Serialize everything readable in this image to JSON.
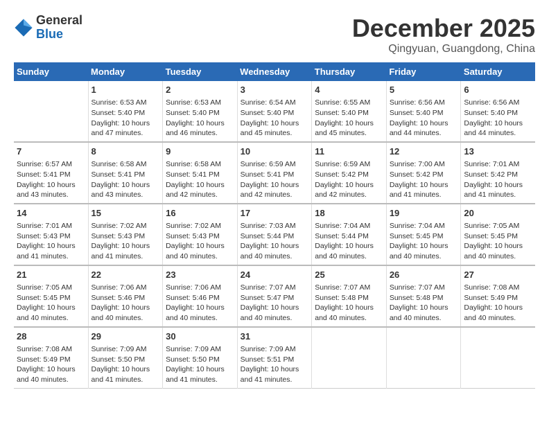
{
  "logo": {
    "line1": "General",
    "line2": "Blue"
  },
  "title": "December 2025",
  "location": "Qingyuan, Guangdong, China",
  "weekdays": [
    "Sunday",
    "Monday",
    "Tuesday",
    "Wednesday",
    "Thursday",
    "Friday",
    "Saturday"
  ],
  "weeks": [
    [
      {
        "day": "",
        "content": ""
      },
      {
        "day": "1",
        "content": "Sunrise: 6:53 AM\nSunset: 5:40 PM\nDaylight: 10 hours\nand 47 minutes."
      },
      {
        "day": "2",
        "content": "Sunrise: 6:53 AM\nSunset: 5:40 PM\nDaylight: 10 hours\nand 46 minutes."
      },
      {
        "day": "3",
        "content": "Sunrise: 6:54 AM\nSunset: 5:40 PM\nDaylight: 10 hours\nand 45 minutes."
      },
      {
        "day": "4",
        "content": "Sunrise: 6:55 AM\nSunset: 5:40 PM\nDaylight: 10 hours\nand 45 minutes."
      },
      {
        "day": "5",
        "content": "Sunrise: 6:56 AM\nSunset: 5:40 PM\nDaylight: 10 hours\nand 44 minutes."
      },
      {
        "day": "6",
        "content": "Sunrise: 6:56 AM\nSunset: 5:40 PM\nDaylight: 10 hours\nand 44 minutes."
      }
    ],
    [
      {
        "day": "7",
        "content": "Sunrise: 6:57 AM\nSunset: 5:41 PM\nDaylight: 10 hours\nand 43 minutes."
      },
      {
        "day": "8",
        "content": "Sunrise: 6:58 AM\nSunset: 5:41 PM\nDaylight: 10 hours\nand 43 minutes."
      },
      {
        "day": "9",
        "content": "Sunrise: 6:58 AM\nSunset: 5:41 PM\nDaylight: 10 hours\nand 42 minutes."
      },
      {
        "day": "10",
        "content": "Sunrise: 6:59 AM\nSunset: 5:41 PM\nDaylight: 10 hours\nand 42 minutes."
      },
      {
        "day": "11",
        "content": "Sunrise: 6:59 AM\nSunset: 5:42 PM\nDaylight: 10 hours\nand 42 minutes."
      },
      {
        "day": "12",
        "content": "Sunrise: 7:00 AM\nSunset: 5:42 PM\nDaylight: 10 hours\nand 41 minutes."
      },
      {
        "day": "13",
        "content": "Sunrise: 7:01 AM\nSunset: 5:42 PM\nDaylight: 10 hours\nand 41 minutes."
      }
    ],
    [
      {
        "day": "14",
        "content": "Sunrise: 7:01 AM\nSunset: 5:43 PM\nDaylight: 10 hours\nand 41 minutes."
      },
      {
        "day": "15",
        "content": "Sunrise: 7:02 AM\nSunset: 5:43 PM\nDaylight: 10 hours\nand 41 minutes."
      },
      {
        "day": "16",
        "content": "Sunrise: 7:02 AM\nSunset: 5:43 PM\nDaylight: 10 hours\nand 40 minutes."
      },
      {
        "day": "17",
        "content": "Sunrise: 7:03 AM\nSunset: 5:44 PM\nDaylight: 10 hours\nand 40 minutes."
      },
      {
        "day": "18",
        "content": "Sunrise: 7:04 AM\nSunset: 5:44 PM\nDaylight: 10 hours\nand 40 minutes."
      },
      {
        "day": "19",
        "content": "Sunrise: 7:04 AM\nSunset: 5:45 PM\nDaylight: 10 hours\nand 40 minutes."
      },
      {
        "day": "20",
        "content": "Sunrise: 7:05 AM\nSunset: 5:45 PM\nDaylight: 10 hours\nand 40 minutes."
      }
    ],
    [
      {
        "day": "21",
        "content": "Sunrise: 7:05 AM\nSunset: 5:45 PM\nDaylight: 10 hours\nand 40 minutes."
      },
      {
        "day": "22",
        "content": "Sunrise: 7:06 AM\nSunset: 5:46 PM\nDaylight: 10 hours\nand 40 minutes."
      },
      {
        "day": "23",
        "content": "Sunrise: 7:06 AM\nSunset: 5:46 PM\nDaylight: 10 hours\nand 40 minutes."
      },
      {
        "day": "24",
        "content": "Sunrise: 7:07 AM\nSunset: 5:47 PM\nDaylight: 10 hours\nand 40 minutes."
      },
      {
        "day": "25",
        "content": "Sunrise: 7:07 AM\nSunset: 5:48 PM\nDaylight: 10 hours\nand 40 minutes."
      },
      {
        "day": "26",
        "content": "Sunrise: 7:07 AM\nSunset: 5:48 PM\nDaylight: 10 hours\nand 40 minutes."
      },
      {
        "day": "27",
        "content": "Sunrise: 7:08 AM\nSunset: 5:49 PM\nDaylight: 10 hours\nand 40 minutes."
      }
    ],
    [
      {
        "day": "28",
        "content": "Sunrise: 7:08 AM\nSunset: 5:49 PM\nDaylight: 10 hours\nand 40 minutes."
      },
      {
        "day": "29",
        "content": "Sunrise: 7:09 AM\nSunset: 5:50 PM\nDaylight: 10 hours\nand 41 minutes."
      },
      {
        "day": "30",
        "content": "Sunrise: 7:09 AM\nSunset: 5:50 PM\nDaylight: 10 hours\nand 41 minutes."
      },
      {
        "day": "31",
        "content": "Sunrise: 7:09 AM\nSunset: 5:51 PM\nDaylight: 10 hours\nand 41 minutes."
      },
      {
        "day": "",
        "content": ""
      },
      {
        "day": "",
        "content": ""
      },
      {
        "day": "",
        "content": ""
      }
    ]
  ]
}
